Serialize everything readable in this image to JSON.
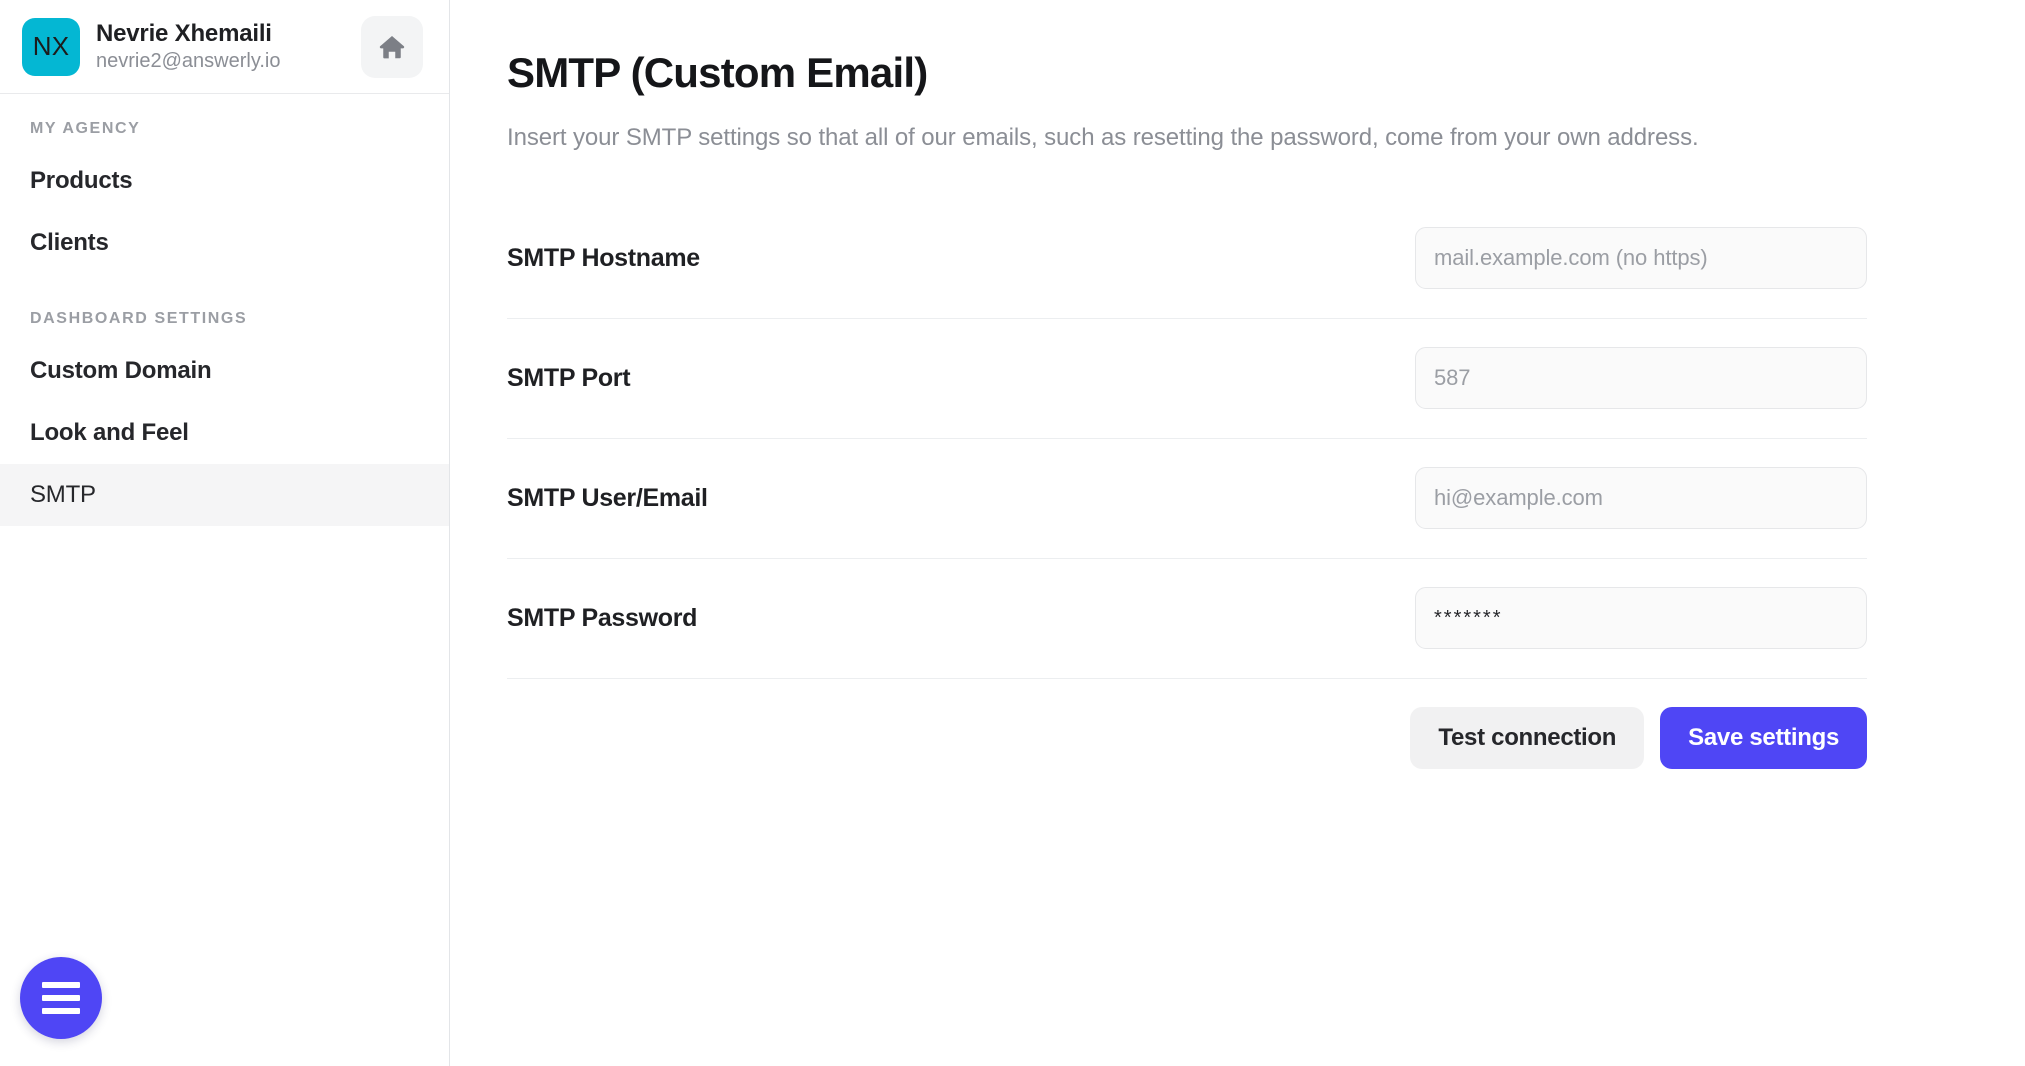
{
  "theme": {
    "accent": "#4f46f5",
    "avatar_bg": "#04b7d3",
    "sidebar_active_bg": "#f5f5f6",
    "input_bg": "#fafafa",
    "muted_text": "#8b8e95"
  },
  "sidebar": {
    "account": {
      "avatar_initials": "NX",
      "name": "Nevrie Xhemaili",
      "email": "nevrie2@answerly.io",
      "home_icon": "home-icon"
    },
    "sections": [
      {
        "title": "MY AGENCY",
        "items": [
          {
            "label": "Products",
            "active": false
          },
          {
            "label": "Clients",
            "active": false
          }
        ]
      },
      {
        "title": "DASHBOARD SETTINGS",
        "items": [
          {
            "label": "Custom Domain",
            "active": false
          },
          {
            "label": "Look and Feel",
            "active": false
          },
          {
            "label": "SMTP",
            "active": true
          }
        ]
      }
    ],
    "fab": {
      "icon": "hamburger-menu-icon"
    }
  },
  "main": {
    "title": "SMTP (Custom Email)",
    "subtitle": "Insert your SMTP settings so that all of our emails, such as resetting the password, come from your own address.",
    "fields": [
      {
        "label": "SMTP Hostname",
        "name": "smtp-hostname",
        "value": "",
        "placeholder": "mail.example.com (no https)",
        "type": "text"
      },
      {
        "label": "SMTP Port",
        "name": "smtp-port",
        "value": "",
        "placeholder": "587",
        "type": "text"
      },
      {
        "label": "SMTP User/Email",
        "name": "smtp-user-email",
        "value": "",
        "placeholder": "hi@example.com",
        "type": "text"
      },
      {
        "label": "SMTP Password",
        "name": "smtp-password",
        "value": "*******",
        "placeholder": "",
        "type": "password"
      }
    ],
    "actions": {
      "test_label": "Test connection",
      "save_label": "Save settings"
    }
  }
}
